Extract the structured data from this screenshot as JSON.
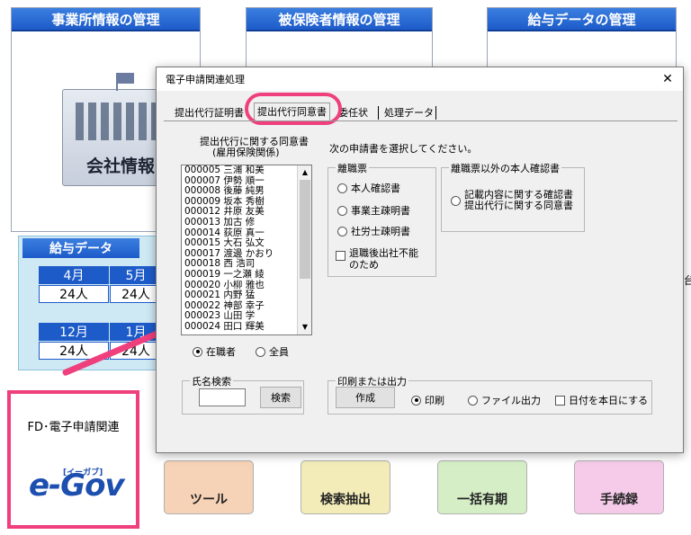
{
  "background": {
    "tiles": {
      "office": "事業所情報の管理",
      "insured": "被保険者情報の管理",
      "salary_mgmt": "給与データの管理"
    },
    "company_button": "会社情報",
    "salary_panel": {
      "title": "給与データ",
      "months": [
        "4月",
        "5月",
        "12月",
        "1月"
      ],
      "values": [
        "24人",
        "24人",
        "24人",
        "24人"
      ]
    },
    "fd_box": {
      "label": "FD･電子申請関連",
      "logo_text": "e-Gov",
      "logo_sub": "[イーガブ]"
    },
    "bottom_tiles": [
      "ツール",
      "検索抽出",
      "一括有期",
      "手続録"
    ],
    "right_edge_text": "台"
  },
  "dialog": {
    "title": "電子申請関連処理",
    "close_glyph": "✕",
    "tabs": [
      "提出代行証明書",
      "提出代行同意書",
      "委任状",
      "処理データ"
    ],
    "active_tab": 1,
    "list_heading_1": "提出代行に関する同意書",
    "list_heading_2": "(雇用保険関係)",
    "employees": [
      "000005 三浦 和美",
      "000007 伊勢 順一",
      "000008 後藤 純男",
      "000009 坂本 秀樹",
      "000012 井原 友美",
      "000013 加古 修",
      "000014 荻原 真一",
      "000015 大石 弘文",
      "000017 渡邊 かおり",
      "000018 西 浩司",
      "000019 一之瀬 綾",
      "000020 小柳 雅也",
      "000021 内野 猛",
      "000022 神部 幸子",
      "000023 山田 学",
      "000024 田口 輝美"
    ],
    "filter": {
      "enrolled": "在職者",
      "all": "全員"
    },
    "instruction": "次の申請書を選択してください。",
    "group_leave": {
      "title": "離職票",
      "options": [
        "本人確認書",
        "事業主疎明書",
        "社労士疎明書"
      ],
      "checkbox": "退職後出社不能のため"
    },
    "group_other": {
      "title": "離職票以外の本人確認書",
      "option_line1": "記載内容に関する確認書",
      "option_line2": "提出代行に関する同意書"
    },
    "name_search": {
      "title": "氏名検索",
      "button": "検索"
    },
    "print_group": {
      "title": "印刷または出力",
      "create_button": "作成",
      "print": "印刷",
      "file_output": "ファイル出力",
      "date_today": "日付を本日にする"
    }
  },
  "colors": {
    "accent": "#ef3f7c",
    "tile_blue": "#1d5bc9"
  }
}
